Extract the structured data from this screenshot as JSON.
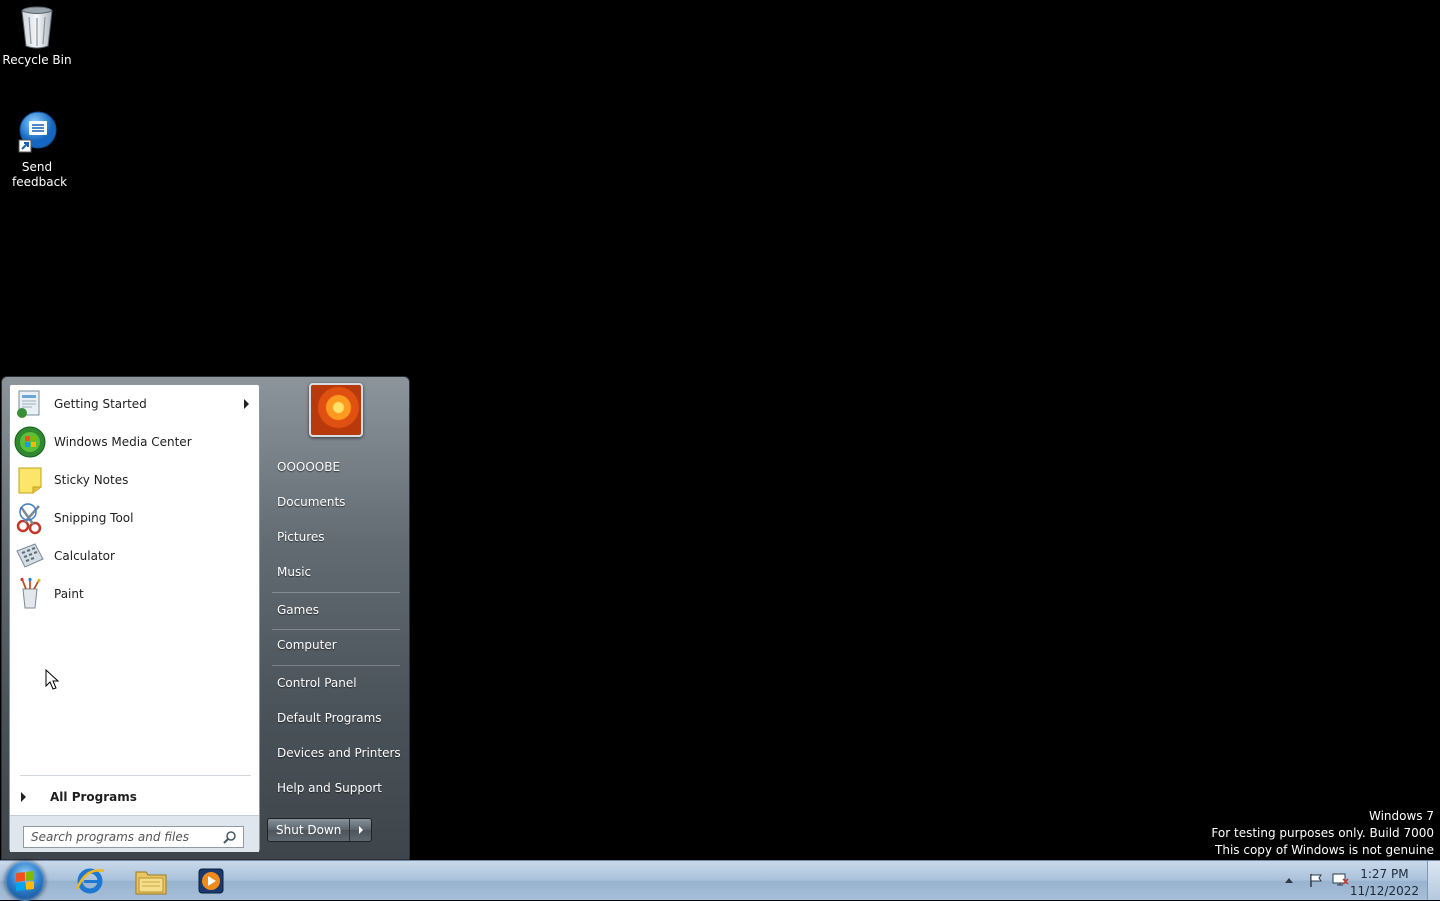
{
  "desktop": {
    "icons": [
      {
        "label": "Recycle Bin",
        "icon": "recycle-bin-icon"
      },
      {
        "label": "Send feedback",
        "icon": "send-feedback-icon"
      }
    ]
  },
  "start_menu": {
    "programs": [
      {
        "label": "Getting Started",
        "icon": "getting-started-icon",
        "has_submenu": true
      },
      {
        "label": "Windows Media Center",
        "icon": "media-center-icon"
      },
      {
        "label": "Sticky Notes",
        "icon": "sticky-notes-icon"
      },
      {
        "label": "Snipping Tool",
        "icon": "snipping-tool-icon"
      },
      {
        "label": "Calculator",
        "icon": "calculator-icon"
      },
      {
        "label": "Paint",
        "icon": "paint-icon"
      }
    ],
    "all_programs_label": "All Programs",
    "search_placeholder": "Search programs and files",
    "user_name": "OOOOOBE",
    "places": [
      {
        "label": "Documents"
      },
      {
        "label": "Pictures"
      },
      {
        "label": "Music"
      },
      {
        "label": "Games"
      },
      {
        "label": "Computer"
      },
      {
        "label": "Control Panel"
      },
      {
        "label": "Default Programs"
      },
      {
        "label": "Devices and Printers"
      },
      {
        "label": "Help and Support"
      }
    ],
    "shutdown_label": "Shut Down"
  },
  "taskbar": {
    "pinned": [
      "internet-explorer-icon",
      "windows-explorer-icon",
      "media-player-icon"
    ],
    "clock_time": "1:27 PM",
    "clock_date": "11/12/2022"
  },
  "watermark": {
    "line1": "Windows 7",
    "line2": "For testing purposes only. Build 7000",
    "line3": "This copy of Windows is not genuine"
  },
  "colors": {
    "desktop_bg": "#000000",
    "taskbar": "#a9c1da",
    "start_orb": "#2e7fcb"
  }
}
